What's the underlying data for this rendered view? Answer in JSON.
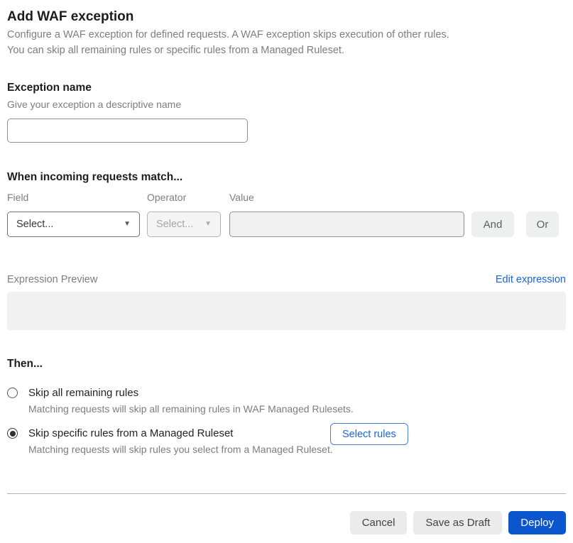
{
  "page": {
    "title": "Add WAF exception",
    "description_line1": "Configure a WAF exception for defined requests. A WAF exception skips execution of other rules.",
    "description_line2": "You can skip all remaining rules or specific rules from a Managed Ruleset."
  },
  "exception_name": {
    "label": "Exception name",
    "help": "Give your exception a descriptive name",
    "value": "",
    "placeholder": ""
  },
  "match": {
    "heading": "When incoming requests match...",
    "field": {
      "label": "Field",
      "selected": "Select..."
    },
    "operator": {
      "label": "Operator",
      "selected": "Select..."
    },
    "value": {
      "label": "Value",
      "value": ""
    },
    "and_label": "And",
    "or_label": "Or"
  },
  "expression": {
    "label": "Expression Preview",
    "edit_link": "Edit expression",
    "preview": ""
  },
  "then": {
    "heading": "Then...",
    "options": [
      {
        "label": "Skip all remaining rules",
        "description": "Matching requests will skip all remaining rules in WAF Managed Rulesets.",
        "selected": false
      },
      {
        "label": "Skip specific rules from a Managed Ruleset",
        "description": "Matching requests will skip rules you select from a Managed Ruleset.",
        "selected": true
      }
    ],
    "select_rules_label": "Select rules"
  },
  "footer": {
    "cancel_label": "Cancel",
    "save_draft_label": "Save as Draft",
    "deploy_label": "Deploy"
  },
  "colors": {
    "accent_blue": "#0b56cf",
    "link_blue": "#1665e3",
    "text_primary": "#1d1d1d",
    "text_muted": "#7d7d7d",
    "disabled_bg": "#f1f1f1",
    "button_gray_bg": "#ebebeb"
  },
  "icons": {
    "chevron_down": "▼"
  }
}
